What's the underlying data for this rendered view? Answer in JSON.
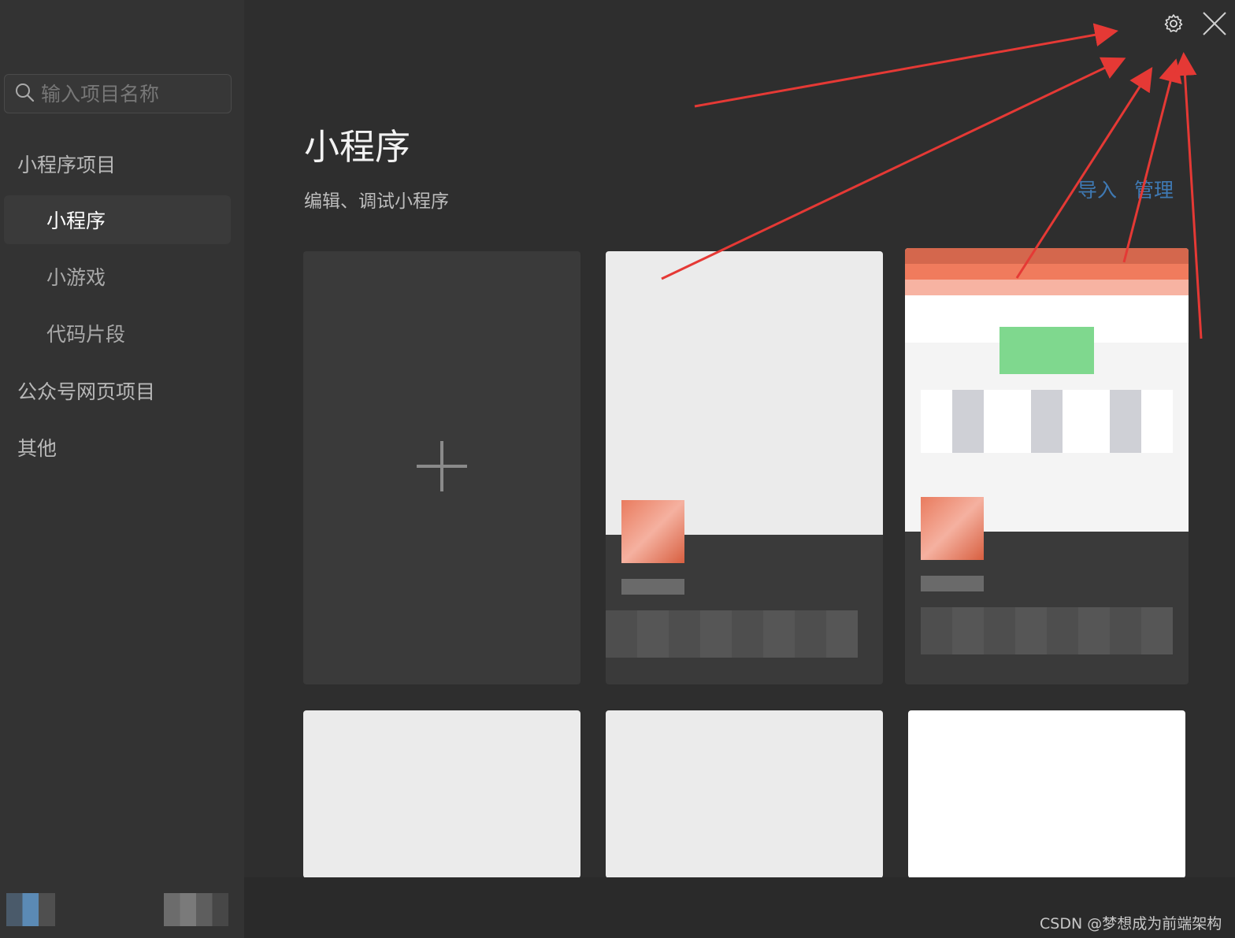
{
  "sidebar": {
    "search_placeholder": "输入项目名称",
    "groups": [
      {
        "label": "小程序项目"
      },
      {
        "label": "公众号网页项目"
      },
      {
        "label": "其他"
      }
    ],
    "items": [
      {
        "label": "小程序",
        "active": true
      },
      {
        "label": "小游戏",
        "active": false
      },
      {
        "label": "代码片段",
        "active": false
      }
    ]
  },
  "main": {
    "title": "小程序",
    "subtitle": "编辑、调试小程序",
    "actions": {
      "import": "导入",
      "manage": "管理"
    }
  },
  "icons": {
    "search": "search-icon",
    "settings": "gear-icon",
    "close": "close-icon",
    "add": "plus-icon"
  },
  "watermark": "CSDN @梦想成为前端架构",
  "colors": {
    "accent_link": "#3f79b3",
    "annotation_arrow": "#e53935"
  }
}
